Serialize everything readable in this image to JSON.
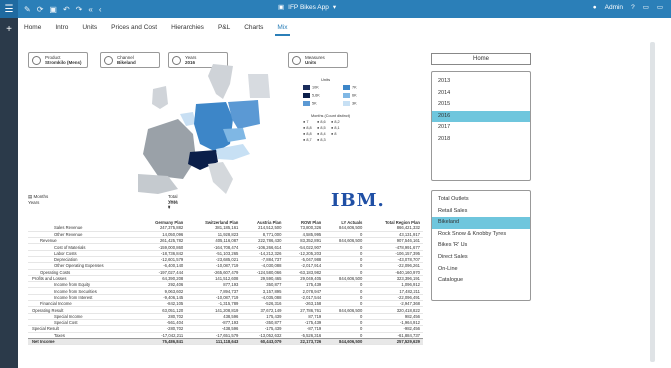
{
  "topbar": {
    "app_title": "IFP Bikes App",
    "user": "Admin",
    "help": "?",
    "tool_icons": [
      "pencil-icon",
      "refresh-icon",
      "save-icon",
      "undo-icon",
      "redo-icon",
      "rewind-icon",
      "share-icon"
    ]
  },
  "tabs": [
    "Home",
    "Intro",
    "Units",
    "Prices and Cost",
    "Hierarchies",
    "P&L",
    "Charts",
    "Mix"
  ],
  "active_tab": "Mix",
  "filters": [
    {
      "title": "Product",
      "value": "Stromkilo (Mens)"
    },
    {
      "title": "Channel",
      "value": "Bikeland"
    },
    {
      "title": "Years",
      "value": "2016"
    },
    {
      "title": "Measures",
      "value": "Units"
    }
  ],
  "home_button": "Home",
  "years": [
    "2013",
    "2014",
    "2015",
    "2016",
    "2017",
    "2018"
  ],
  "selected_year": "2016",
  "legend": {
    "title": "Units",
    "items": [
      {
        "label": "10K",
        "color": "#1a2c5b"
      },
      {
        "label": "7K",
        "color": "#3d86c8"
      },
      {
        "label": "5,6K",
        "color": "#0b1f4a"
      },
      {
        "label": "6K",
        "color": "#7fb7e4"
      },
      {
        "label": "5K",
        "color": "#5b99d4"
      },
      {
        "label": "3K",
        "color": "#c7e0f4"
      }
    ],
    "months_title": "Months (Count distinct)",
    "months": [
      "7",
      "8,6",
      "8,2",
      "8,8",
      "8,5",
      "8,1",
      "8,8",
      "8,4",
      "8",
      "8,7",
      "8,3"
    ]
  },
  "logo_text": "IBM.",
  "dims": {
    "row1_label": "Months",
    "row2_label": "Years",
    "row2_value": "2016",
    "col_label": "Total Year",
    "col_value": "2016"
  },
  "table": {
    "headers": [
      "",
      "Germany Plan",
      "Switzerland Plan",
      "Austria Plan",
      "ROW Plan",
      "LY Actuals",
      "Total Region Plan"
    ],
    "rows": [
      [
        "Sales Revenue",
        "247,375,882",
        "381,185,161",
        "214,512,500",
        "73,800,326",
        "844,606,500",
        "866,421,332"
      ],
      [
        "Other Revenue",
        "14,050,096",
        "11,928,823",
        "8,771,000",
        "4,585,995",
        "0",
        "43,131,917"
      ],
      [
        "Revenue",
        "261,425,782",
        "405,116,087",
        "222,786,430",
        "83,352,891",
        "844,606,500",
        "907,546,161"
      ],
      [
        "Cost of Materials",
        "-159,000,860",
        "-164,708,474",
        "-106,266,614",
        "-54,022,907",
        "0",
        "-478,991,677"
      ],
      [
        "Labor Costs",
        "-18,736,842",
        "-51,103,265",
        "-14,212,326",
        "-12,205,203",
        "0",
        "-106,157,395"
      ],
      [
        "Depreciation",
        "-12,601,579",
        "-23,685,021",
        "-7,884,737",
        "-5,047,988",
        "0",
        "-43,078,707"
      ],
      [
        "Other Operating Expenses",
        "-6,400,140",
        "-10,087,719",
        "-4,030,088",
        "-2,017,914",
        "0",
        "-22,096,261"
      ],
      [
        "Operating Costs",
        "-197,027,444",
        "-265,607,479",
        "-124,580,066",
        "-63,183,982",
        "0",
        "-640,160,970"
      ],
      [
        "Profits and Losses",
        "64,390,208",
        "141,512,608",
        "29,590,465",
        "29,049,405",
        "844,606,500",
        "323,396,191"
      ],
      [
        "Income from Equity",
        "292,406",
        "877,193",
        "350,877",
        "175,439",
        "0",
        "1,096,912"
      ],
      [
        "Income from Securities",
        "9,063,602",
        "7,894,737",
        "3,157,895",
        "2,078,947",
        "0",
        "17,482,211"
      ],
      [
        "Income from Interest",
        "-9,406,145",
        "-10,087,719",
        "-4,035,088",
        "-2,017,544",
        "0",
        "-22,096,491"
      ],
      [
        "Financial Income",
        "-842,105",
        "-1,315,789",
        "-526,316",
        "-263,158",
        "0",
        "-2,947,368"
      ],
      [
        "Operating Result",
        "63,051,120",
        "141,208,819",
        "37,672,149",
        "27,786,761",
        "844,606,500",
        "320,418,822"
      ],
      [
        "Special Income",
        "280,702",
        "438,596",
        "175,439",
        "87,719",
        "0",
        "982,456"
      ],
      [
        "Special Cost",
        "-561,404",
        "-877,193",
        "-350,877",
        "-175,439",
        "0",
        "-1,964,912"
      ],
      [
        "Special Result",
        "-280,702",
        "-438,596",
        "-175,439",
        "-87,719",
        "0",
        "-982,456"
      ],
      [
        "Taxes",
        "-17,042,211",
        "-17,651,579",
        "-13,052,632",
        "-5,526,316",
        "0",
        "-61,884,737"
      ],
      [
        "Net Income",
        "75,486,841",
        "111,118,643",
        "60,443,079",
        "22,173,726",
        "844,606,500",
        "257,529,629"
      ]
    ]
  },
  "outlets": [
    "Total Outlets",
    "Retail Sales",
    "Bikeland",
    "Rock Snow & Knobby Tyres",
    "Bikes 'R' Us",
    "Direct Sales",
    "On-Line",
    "Catalogue"
  ],
  "selected_outlet": "Bikeland"
}
